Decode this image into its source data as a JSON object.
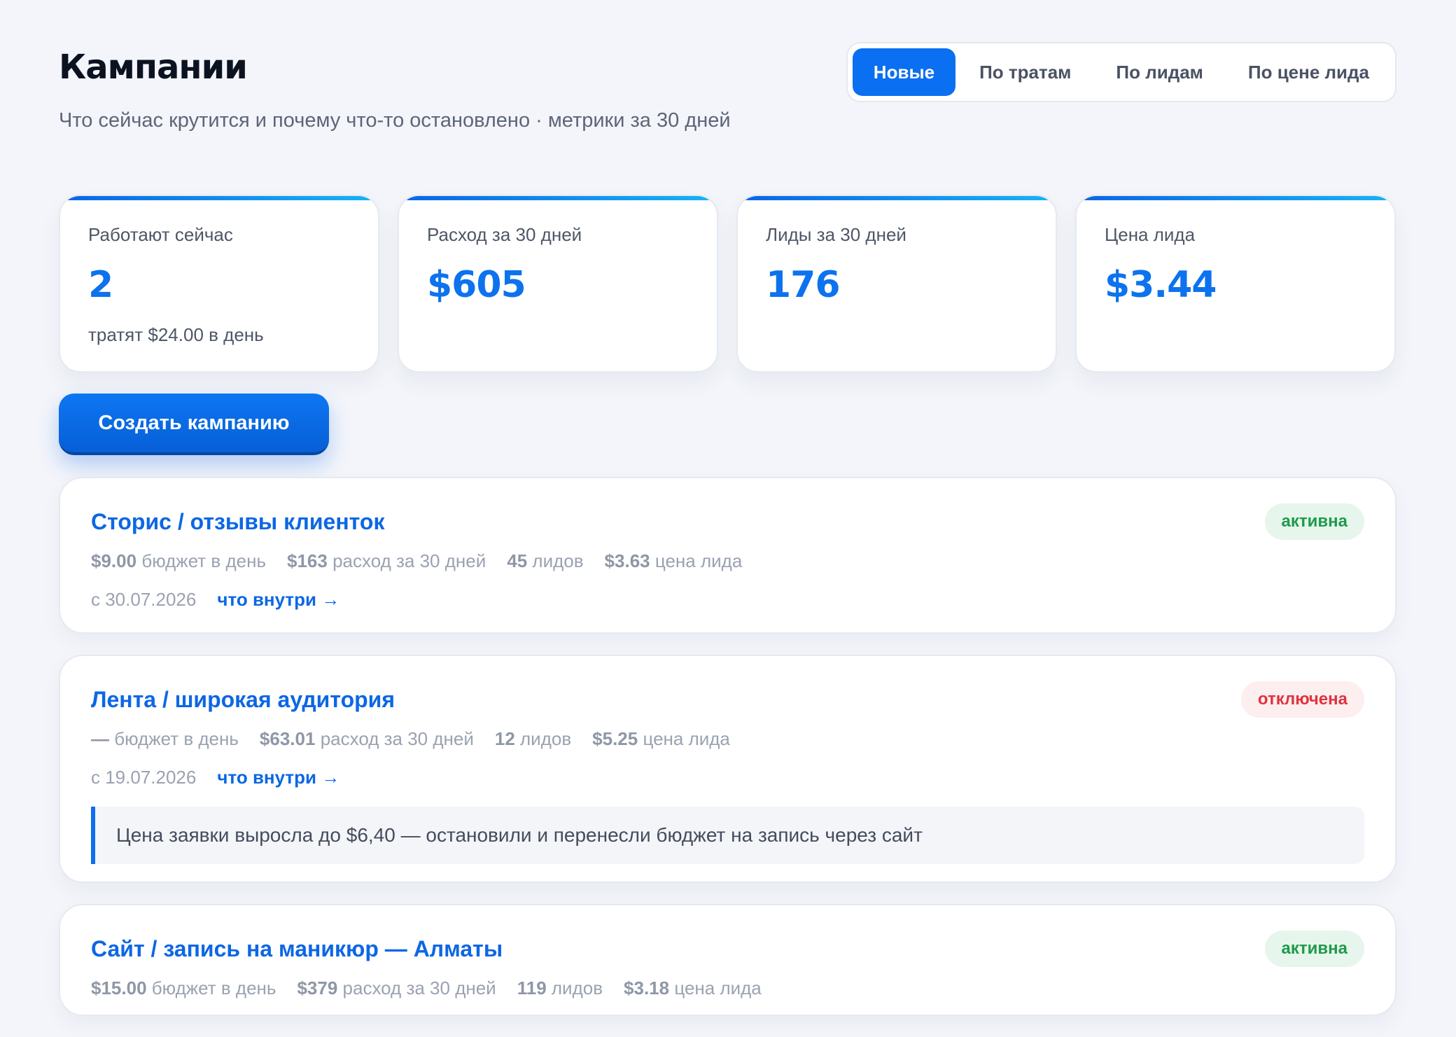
{
  "header": {
    "title": "Кампании",
    "subtitle": "Что сейчас крутится и почему что-то остановлено · метрики за 30 дней"
  },
  "sort_tabs": [
    {
      "label": "Новые",
      "active": true
    },
    {
      "label": "По тратам",
      "active": false
    },
    {
      "label": "По лидам",
      "active": false
    },
    {
      "label": "По цене лида",
      "active": false
    }
  ],
  "stats": [
    {
      "label": "Работают сейчас",
      "value": "2",
      "sub": "тратят $24.00 в день"
    },
    {
      "label": "Расход за 30 дней",
      "value": "$605",
      "sub": ""
    },
    {
      "label": "Лиды за 30 дней",
      "value": "176",
      "sub": ""
    },
    {
      "label": "Цена лида",
      "value": "$3.44",
      "sub": ""
    }
  ],
  "create_button": "Создать кампанию",
  "campaigns": [
    {
      "name": "Сторис / отзывы клиенток",
      "status": "активна",
      "budget": "$9.00",
      "budget_label": "бюджет в день",
      "spend": "$163",
      "spend_label": "расход за 30 дней",
      "leads": "45",
      "leads_label": "лидов",
      "cpl": "$3.63",
      "cpl_label": "цена лида",
      "since": "с 30.07.2026",
      "link": "что внутри →",
      "note": ""
    },
    {
      "name": "Лента / широкая аудитория",
      "status": "отключена",
      "budget": "—",
      "budget_label": "бюджет в день",
      "spend": "$63.01",
      "spend_label": "расход за 30 дней",
      "leads": "12",
      "leads_label": "лидов",
      "cpl": "$5.25",
      "cpl_label": "цена лида",
      "since": "с 19.07.2026",
      "link": "что внутри →",
      "note": "Цена заявки выросла до $6,40 — остановили и перенесли бюджет на запись через сайт"
    },
    {
      "name": "Сайт / запись на маникюр — Алматы",
      "status": "активна",
      "budget": "$15.00",
      "budget_label": "бюджет в день",
      "spend": "$379",
      "spend_label": "расход за 30 дней",
      "leads": "119",
      "leads_label": "лидов",
      "cpl": "$3.18",
      "cpl_label": "цена лида",
      "since": "",
      "link": "",
      "note": ""
    }
  ]
}
